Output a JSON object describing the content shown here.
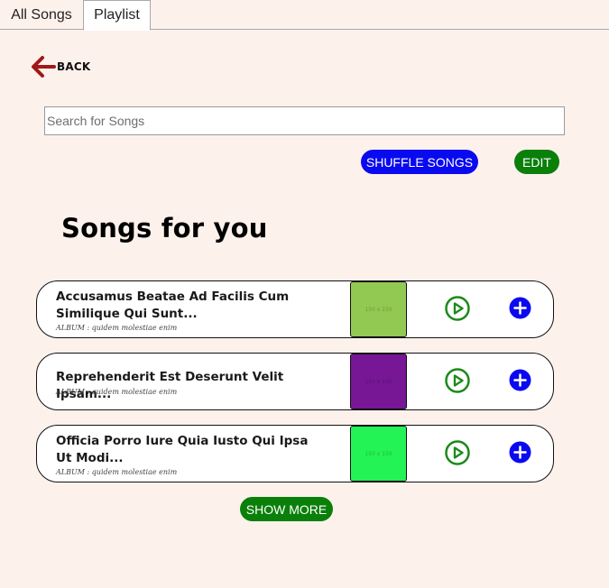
{
  "tabs": [
    {
      "label": "All Songs"
    },
    {
      "label": "Playlist",
      "active": true
    }
  ],
  "nav": {
    "back_label": "BACK",
    "back_icon": "arrow-left-icon"
  },
  "search": {
    "placeholder": "Search for Songs",
    "value": ""
  },
  "actions": {
    "shuffle_label": "SHUFFLE SONGS",
    "edit_label": "EDIT"
  },
  "section": {
    "title": "Songs for you"
  },
  "songs": [
    {
      "title": "Accusamus Beatae Ad Facilis Cum Similique Qui Sunt...",
      "album": "ALBUM : quidem molestiae enim",
      "thumb_text": "150 x 150",
      "thumb_color": "#92c952"
    },
    {
      "title": "Reprehenderit Est Deserunt Velit Ipsam...",
      "album": "ALBUM : quidem molestiae enim",
      "thumb_text": "150 x 150",
      "thumb_color": "#771796"
    },
    {
      "title": "Officia Porro Iure Quia Iusto Qui Ipsa Ut Modi...",
      "album": "ALBUM : quidem molestiae enim",
      "thumb_text": "150 x 150",
      "thumb_color": "#24f355"
    }
  ],
  "footer": {
    "show_more_label": "SHOW MORE"
  },
  "colors": {
    "background": "#fdf1ec",
    "primary_blue": "#0a0af0",
    "primary_green": "#0a800a",
    "back_arrow": "#a01818",
    "play_icon": "#1a8a1a",
    "add_icon": "#0a0af0"
  },
  "icons": {
    "play": "play-circle-icon",
    "add": "plus-circle-icon"
  }
}
